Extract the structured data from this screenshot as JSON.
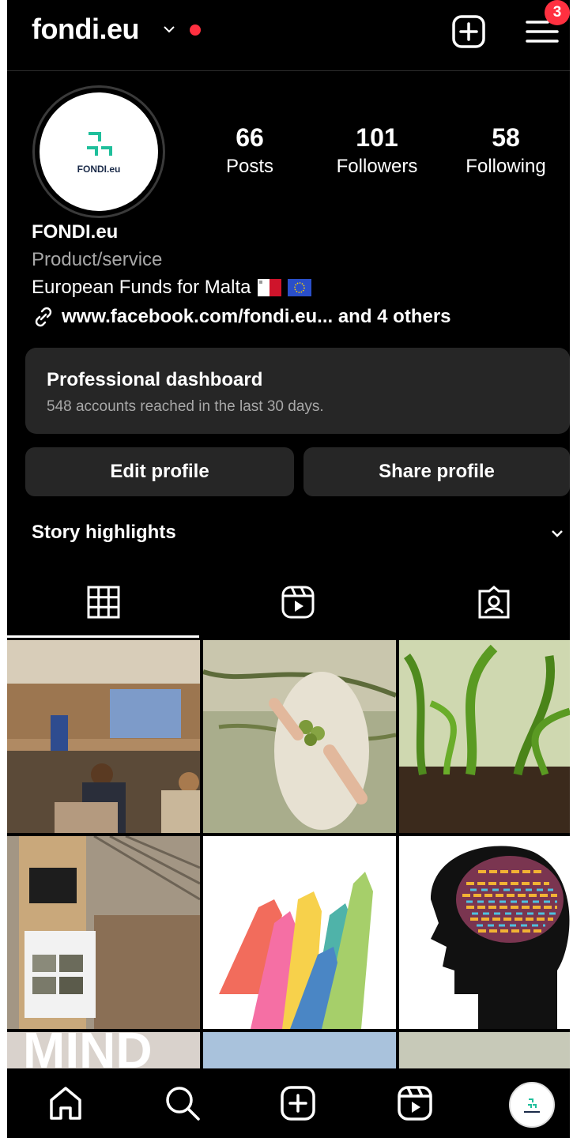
{
  "header": {
    "username": "fondi.eu",
    "notification_count": "3",
    "accent_color": "#ff3040"
  },
  "profile": {
    "avatar_logo_text": "FONDI.eu",
    "name": "FONDI.eu",
    "category": "Product/service",
    "bio": "European Funds for Malta",
    "link": "www.facebook.com/fondi.eu... and 4 others"
  },
  "stats": [
    {
      "value": "66",
      "label": "Posts"
    },
    {
      "value": "101",
      "label": "Followers"
    },
    {
      "value": "58",
      "label": "Following"
    }
  ],
  "dashboard": {
    "title": "Professional dashboard",
    "subtitle": "548 accounts reached in the last 30 days."
  },
  "actions": {
    "edit": "Edit profile",
    "share": "Share profile"
  },
  "highlights": {
    "label": "Story highlights"
  },
  "tabs": [
    "grid-icon",
    "reels-icon",
    "tagged-icon"
  ],
  "posts": [
    {
      "subject": "conference-room"
    },
    {
      "subject": "olive-harvest"
    },
    {
      "subject": "corn-seedlings"
    },
    {
      "subject": "greenhouse-poster"
    },
    {
      "subject": "raised-hands"
    },
    {
      "subject": "head-silhouette"
    }
  ],
  "post_overlay_text": "MIND",
  "nav": [
    "home-icon",
    "search-icon",
    "create-icon",
    "reels-icon",
    "profile-avatar"
  ]
}
